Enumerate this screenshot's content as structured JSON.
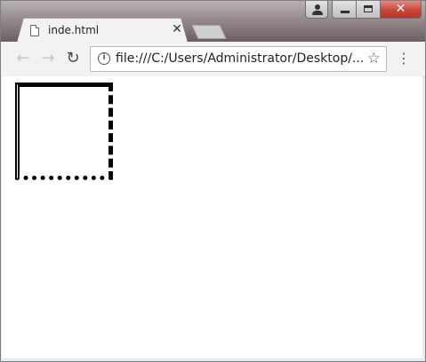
{
  "browser": {
    "tab": {
      "title": "inde.html",
      "close_glyph": "✕",
      "favicon": "file-icon"
    },
    "new_tab": "new-tab-button",
    "caption_buttons": {
      "user_icon": "user-icon",
      "minimize": "minimize-icon",
      "maximize": "maximize-icon",
      "close_glyph": "✕"
    },
    "toolbar": {
      "back_glyph": "←",
      "forward_glyph": "→",
      "reload_glyph": "↻",
      "info_glyph": "i",
      "url": "file:///C:/Users/Administrator/Desktop/...",
      "star_glyph": "☆",
      "menu_glyph": "⋮"
    }
  },
  "page": {
    "demo_box": {
      "border_styles": {
        "top": "solid",
        "right": "dashed",
        "bottom": "dotted",
        "left": "double"
      },
      "border_color": "#000000",
      "background": "#ffffff"
    }
  }
}
